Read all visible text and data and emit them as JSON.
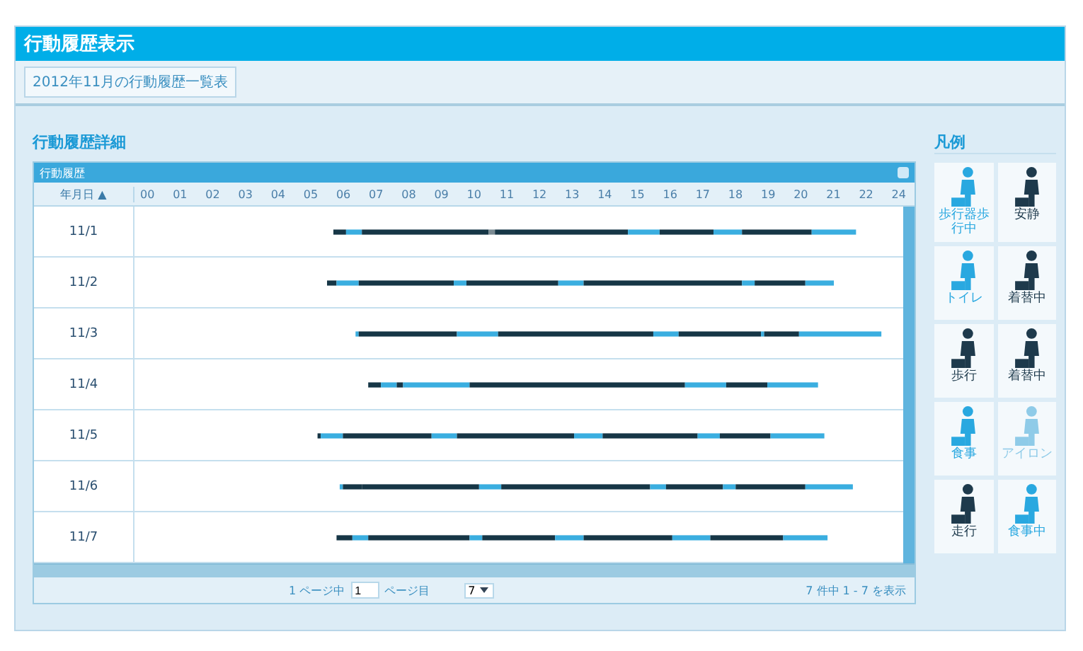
{
  "window": {
    "title": "行動履歴表示"
  },
  "tabs": [
    {
      "label": "2012年11月の行動履歴一覧表",
      "selected": true
    }
  ],
  "section_title": "行動履歴詳細",
  "grid": {
    "title": "行動履歴",
    "date_column": "年月日 ▲",
    "hours": [
      "00",
      "01",
      "02",
      "03",
      "04",
      "05",
      "06",
      "07",
      "08",
      "09",
      "10",
      "11",
      "12",
      "13",
      "14",
      "15",
      "16",
      "17",
      "18",
      "19",
      "20",
      "21",
      "22",
      "24"
    ],
    "rows": [
      {
        "date": "11/1"
      },
      {
        "date": "11/2"
      },
      {
        "date": "11/3"
      },
      {
        "date": "11/4"
      },
      {
        "date": "11/5"
      },
      {
        "date": "11/6"
      },
      {
        "date": "11/7"
      }
    ]
  },
  "pager": {
    "page_before": "1 ページ中",
    "page": "1",
    "page_after": "ページ目",
    "page_size": "7",
    "summary": "7 件中 1 - 7 を表示"
  },
  "legend": {
    "title": "凡例",
    "items": [
      {
        "label": "歩行器歩行中",
        "color": "#29a8e0"
      },
      {
        "label": "安静",
        "color": "#1e3a4c"
      },
      {
        "label": "トイレ",
        "color": "#29a8e0"
      },
      {
        "label": "着替中",
        "color": "#1e3a4c"
      },
      {
        "label": "歩行",
        "color": "#1e3a4c"
      },
      {
        "label": "着替中",
        "color": "#1e3a4c"
      },
      {
        "label": "食事",
        "color": "#29a8e0"
      },
      {
        "label": "アイロン",
        "color": "#8fcbe8"
      },
      {
        "label": "走行",
        "color": "#1e3a4c"
      },
      {
        "label": "食事中",
        "color": "#29a8e0"
      }
    ]
  }
}
